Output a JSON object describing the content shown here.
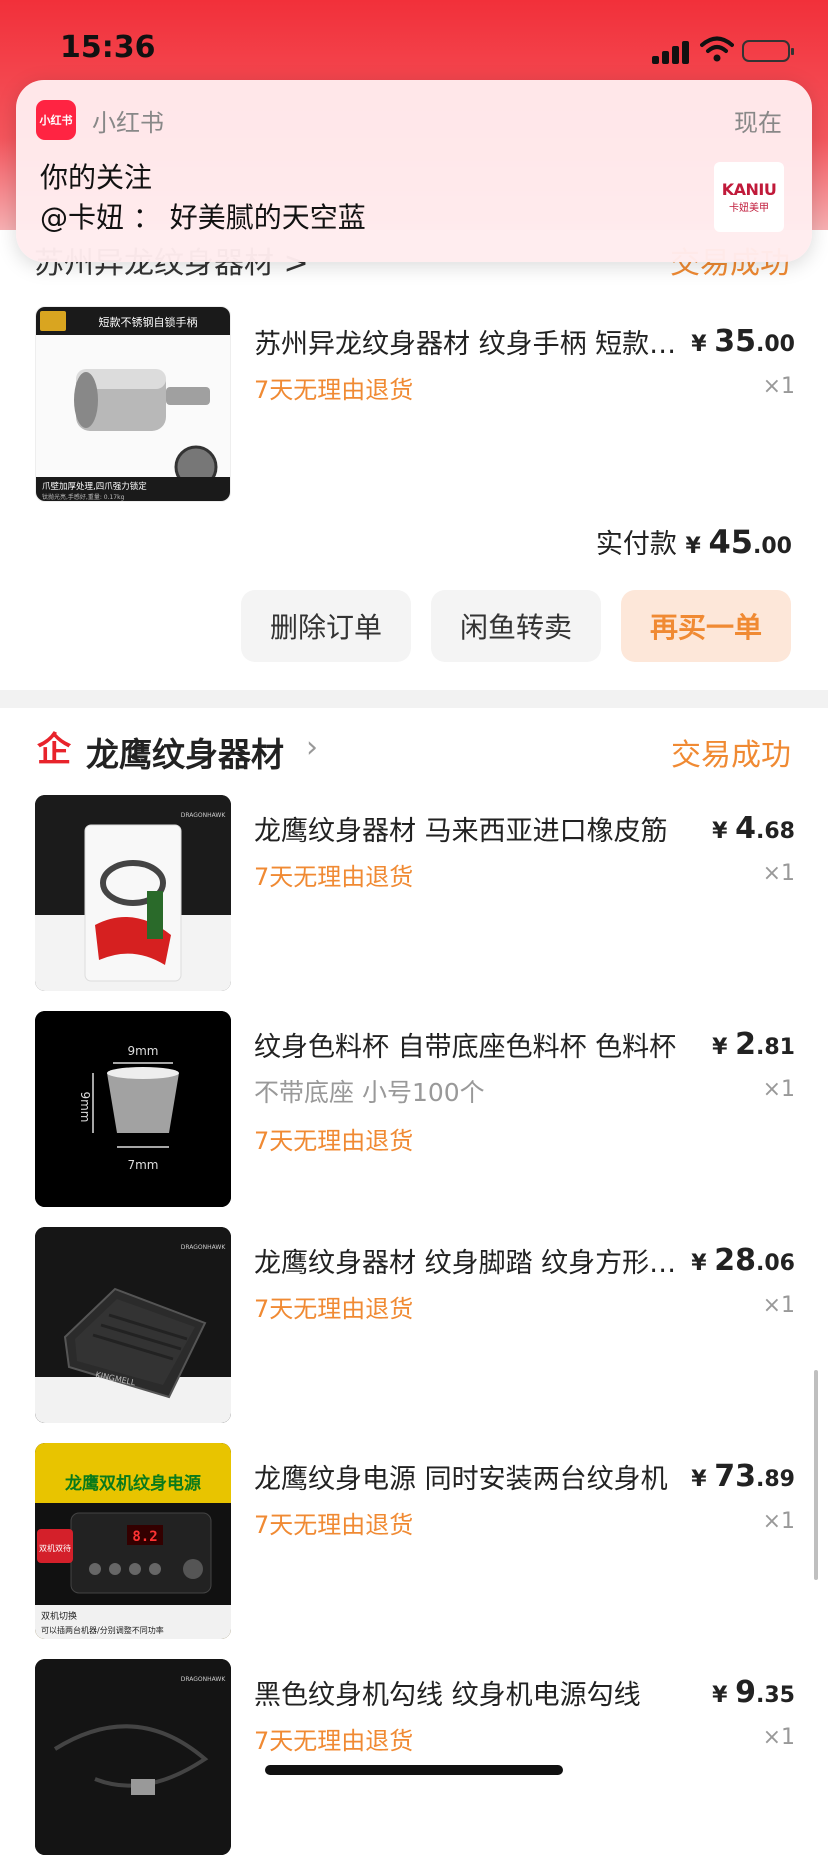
{
  "status_bar": {
    "time": "15:36"
  },
  "notification": {
    "app_icon_text": "小红书",
    "app_name": "小红书",
    "time": "现在",
    "title": "你的关注",
    "body": "@卡妞 ： 好美腻的天空蓝",
    "thumb_brand": "KANIU",
    "thumb_sub": "卡妞美甲"
  },
  "partial_shop": {
    "name": "苏州异龙纹身器材 >",
    "status": "交易成功"
  },
  "order1": {
    "product": {
      "title": "苏州异龙纹身器材 纹身手柄 短款不锈钢自锁",
      "price_int": "35",
      "price_dec": ".00",
      "currency": "¥",
      "refund": "7天无理由退货",
      "qty": "×1",
      "thumb_caption_top": "短款不锈钢自锁手柄",
      "thumb_caption_bottom": "爪壁加厚处理,四爪强力锁定",
      "thumb_caption_tiny": "钛抛光亮,手感好,重量: 0.17kg"
    },
    "paid_label": "实付款",
    "paid_currency": "¥",
    "paid_int": "45",
    "paid_dec": ".00",
    "buttons": {
      "delete": "删除订单",
      "resell": "闲鱼转卖",
      "rebuy": "再买一单"
    }
  },
  "shop2": {
    "icon": "企",
    "name": "龙鹰纹身器材",
    "chevron": "›",
    "status": "交易成功",
    "items": [
      {
        "title": "龙鹰纹身器材 马来西亚进口橡皮筋",
        "currency": "¥",
        "price_int": "4",
        "price_dec": ".68",
        "variant": "",
        "refund": "7天无理由退货",
        "qty": "×1"
      },
      {
        "title": "纹身色料杯 自带底座色料杯 色料杯",
        "currency": "¥",
        "price_int": "2",
        "price_dec": ".81",
        "variant": "不带底座  小号100个",
        "refund": "7天无理由退货",
        "qty": "×1",
        "dim_w": "9mm",
        "dim_h": "9mm",
        "dim_b": "7mm"
      },
      {
        "title": "龙鹰纹身器材 纹身脚踏 纹身方形脚踏",
        "currency": "¥",
        "price_int": "28",
        "price_dec": ".06",
        "variant": "",
        "refund": "7天无理由退货",
        "qty": "×1",
        "pedal_brand": "KINGMELL"
      },
      {
        "title": "龙鹰纹身电源 同时安装两台纹身机",
        "currency": "¥",
        "price_int": "73",
        "price_dec": ".89",
        "variant": "",
        "refund": "7天无理由退货",
        "qty": "×1",
        "banner": "龙鹰双机纹身电源",
        "tag": "双机双待",
        "caption1": "双机切换",
        "caption2": "可以插两台机器/分别调整不同功率",
        "display": "8.2"
      },
      {
        "title": "黑色纹身机勾线 纹身机电源勾线",
        "currency": "¥",
        "price_int": "9",
        "price_dec": ".35",
        "variant": "",
        "refund": "7天无理由退货",
        "qty": "×1"
      }
    ]
  },
  "brand_small": "DRAGONHAWK",
  "colors": {
    "accent": "#f08a33",
    "red": "#e8232b",
    "notification_bg": "#ffeced"
  }
}
